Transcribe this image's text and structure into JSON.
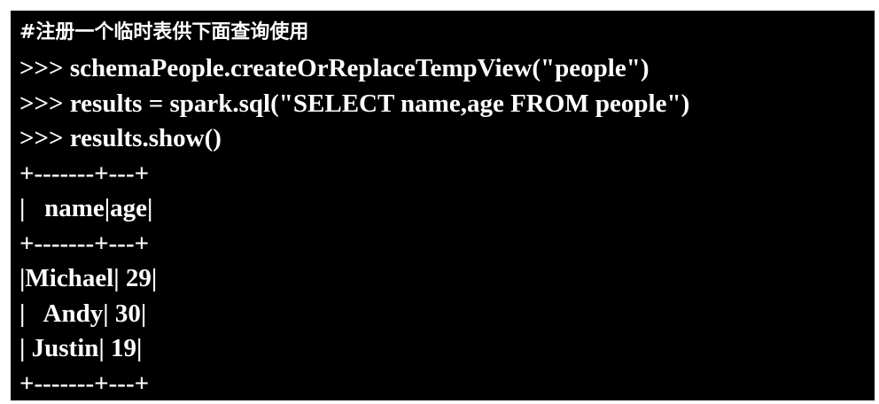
{
  "terminal": {
    "lines": [
      "#注册一个临时表供下面查询使用",
      ">>> schemaPeople.createOrReplaceTempView(\"people\")",
      ">>> results = spark.sql(\"SELECT name,age FROM people\")",
      ">>> results.show()",
      "+-------+---+",
      "|   name|age|",
      "+-------+---+",
      "|Michael| 29|",
      "|   Andy| 30|",
      "| Justin| 19|",
      "+-------+---+"
    ]
  }
}
